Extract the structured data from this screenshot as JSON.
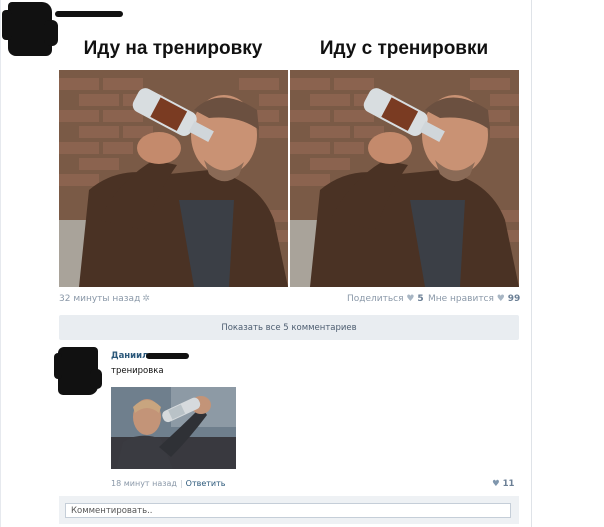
{
  "post": {
    "time": "32 минуты назад",
    "caption_left": "Иду на тренировку",
    "caption_right": "Иду с тренировки",
    "share_label": "Поделиться",
    "share_count": "5",
    "like_label": "Мне нравится",
    "like_count": "99"
  },
  "comments": {
    "show_all_label": "Показать все 5 комментариев",
    "items": [
      {
        "author_visible": "Даниил",
        "text": "тренировка",
        "time": "18 минут назад",
        "reply_label": "Ответить",
        "likes": "11"
      }
    ]
  },
  "composer": {
    "placeholder": "Комментировать.."
  },
  "icons": {
    "settings": "gear-icon",
    "share": "share-heart-icon",
    "like": "heart-icon"
  },
  "colors": {
    "link": "#2b587a",
    "meta": "#8a98a8",
    "button_bg": "#e9edf1"
  }
}
